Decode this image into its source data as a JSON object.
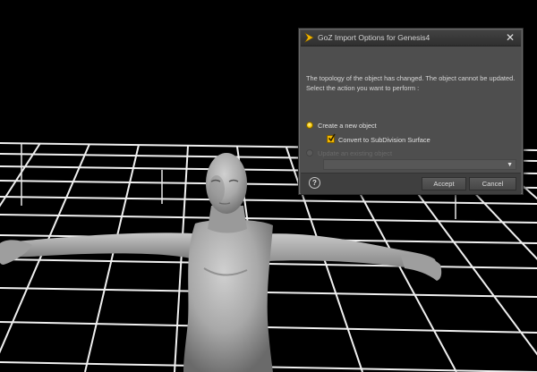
{
  "dialog": {
    "title": "GoZ Import Options for Genesis4",
    "close_glyph": "✕",
    "message": "The topology of the object has changed. The object cannot be updated. Select the action you want to perform :",
    "option_create_label": "Create a new object",
    "option_create_selected": true,
    "convert_label": "Convert to SubDivision Surface",
    "convert_checked": true,
    "option_update_label": "Update an existing object",
    "option_update_enabled": false,
    "existing_object_value": "",
    "help_glyph": "?",
    "accept_label": "Accept",
    "cancel_label": "Cancel"
  },
  "icons": {
    "app": "goz-icon",
    "close": "close-icon",
    "help": "help-icon",
    "dropdown": "chevron-down-icon"
  },
  "colors": {
    "accent": "#f2b600",
    "dialog_bg": "#4e4e4e",
    "viewport_bg": "#000000",
    "grid": "#f5f5f5",
    "figure": "#a6a6a6"
  }
}
